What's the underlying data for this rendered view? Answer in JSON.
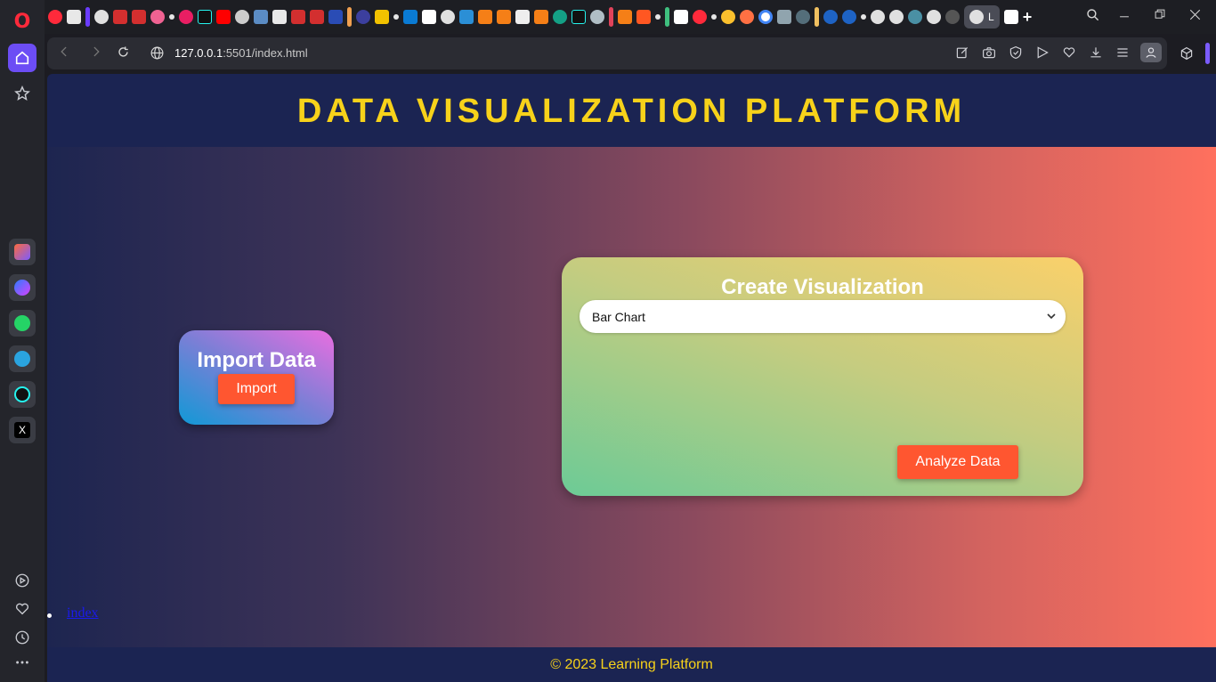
{
  "browser": {
    "url_host": "127.0.0.1",
    "url_rest": ":5501/index.html",
    "active_tab_label": "L"
  },
  "page": {
    "title": "DATA VISUALIZATION PLATFORM",
    "import_card": {
      "heading": "Import Data",
      "button_label": "Import"
    },
    "viz_card": {
      "heading": "Create Visualization",
      "chart_type_selected": "Bar Chart",
      "analyze_label": "Analyze Data"
    },
    "nav": {
      "items": [
        "index"
      ]
    },
    "footer": "© 2023 Learning Platform"
  },
  "colors": {
    "title_yellow": "#f7d21a",
    "header_navy": "#1b2452",
    "button_orange": "#ff5630",
    "opera_accent": "#6c4df5"
  },
  "icons": {
    "sidebar": [
      "opera-logo-icon",
      "home-icon",
      "star-icon",
      "aria-icon",
      "messenger-icon",
      "whatsapp-icon",
      "telegram-icon",
      "tiktok-icon",
      "x-icon",
      "player-icon",
      "heart-icon",
      "history-icon",
      "more-icon"
    ],
    "toolbar": [
      "snapshot-edit-icon",
      "camera-icon",
      "shield-icon",
      "send-icon",
      "heart-icon",
      "download-icon",
      "easy-setup-icon",
      "profile-icon"
    ]
  }
}
